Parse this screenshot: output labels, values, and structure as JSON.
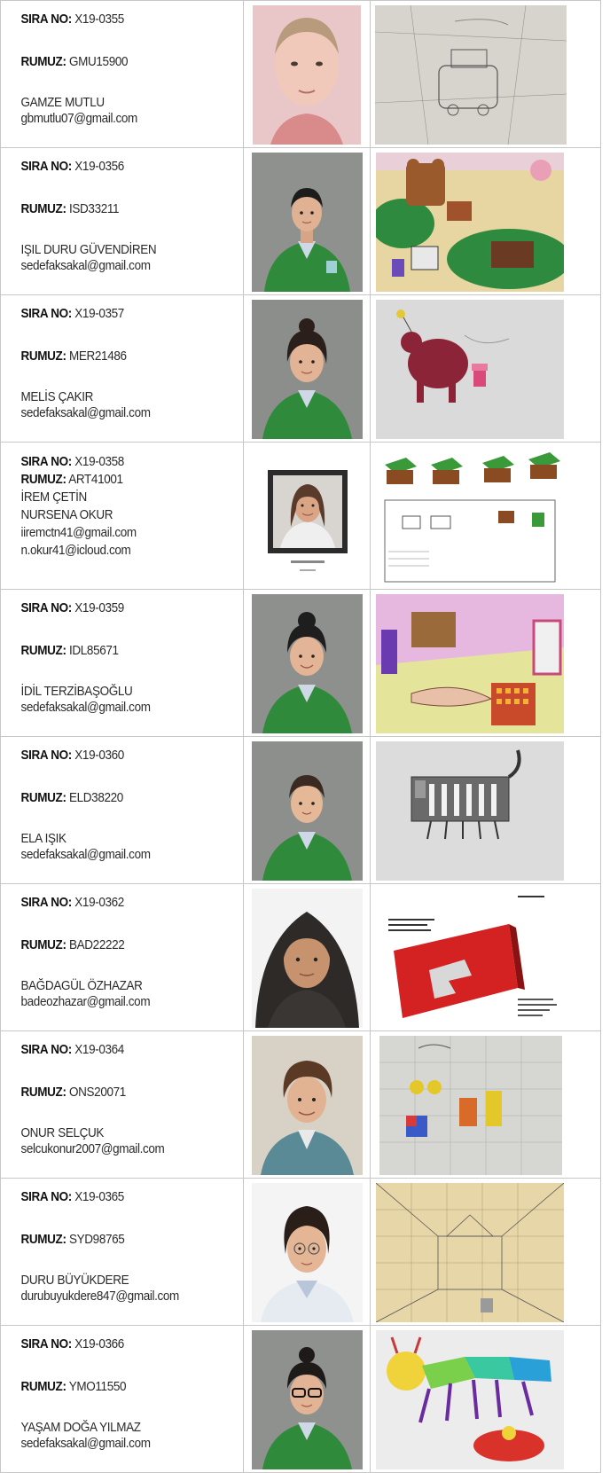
{
  "labels": {
    "sira": "SIRA NO:",
    "rumuz": "RUMUZ:"
  },
  "rows": [
    {
      "sira": "X19-0355",
      "rumuz": "GMU15900",
      "names": [
        "GAMZE MUTLU"
      ],
      "emails": [
        "gbmutlu07@gmail.com"
      ]
    },
    {
      "sira": "X19-0356",
      "rumuz": "ISD33211",
      "names": [
        "IŞIL DURU GÜVENDİREN"
      ],
      "emails": [
        "sedefaksakal@gmail.com"
      ]
    },
    {
      "sira": "X19-0357",
      "rumuz": "MER21486",
      "names": [
        "MELİS ÇAKIR"
      ],
      "emails": [
        "sedefaksakal@gmail.com"
      ]
    },
    {
      "sira": "X19-0358",
      "rumuz": "ART41001",
      "names": [
        "İREM ÇETİN",
        "NURSENA OKUR"
      ],
      "emails": [
        "iiremctn41@gmail.com",
        "n.okur41@icloud.com"
      ]
    },
    {
      "sira": "X19-0359",
      "rumuz": "IDL85671",
      "names": [
        "İDİL TERZİBAŞOĞLU"
      ],
      "emails": [
        "sedefaksakal@gmail.com"
      ]
    },
    {
      "sira": "X19-0360",
      "rumuz": "ELD38220",
      "names": [
        "ELA IŞIK"
      ],
      "emails": [
        "sedefaksakal@gmail.com"
      ]
    },
    {
      "sira": "X19-0362",
      "rumuz": "BAD22222",
      "names": [
        "BAĞDAGÜL ÖZHAZAR"
      ],
      "emails": [
        "badeozhazar@gmail.com"
      ]
    },
    {
      "sira": "X19-0364",
      "rumuz": "ONS20071",
      "names": [
        "ONUR SELÇUK"
      ],
      "emails": [
        "selcukonur2007@gmail.com"
      ]
    },
    {
      "sira": "X19-0365",
      "rumuz": "SYD98765",
      "names": [
        "DURU BÜYÜKDERE"
      ],
      "emails": [
        "durubuyukdere847@gmail.com"
      ]
    },
    {
      "sira": "X19-0366",
      "rumuz": "YMO11550",
      "names": [
        "YAŞAM DOĞA YILMAZ"
      ],
      "emails": [
        "sedefaksakal@gmail.com"
      ]
    }
  ]
}
